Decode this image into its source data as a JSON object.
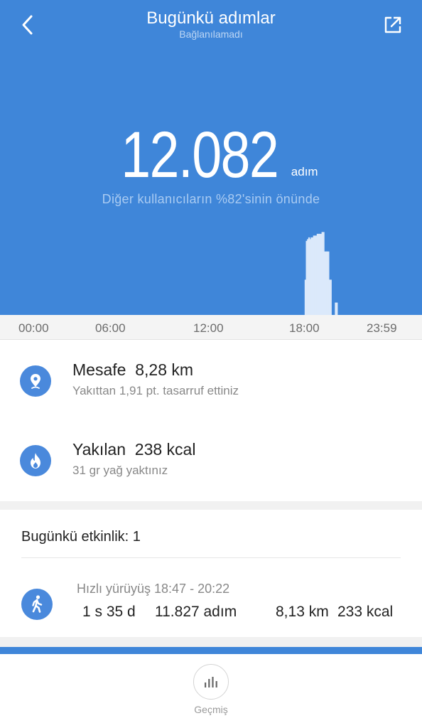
{
  "header": {
    "title": "Bugünkü adımlar",
    "subtitle": "Bağlanılamadı"
  },
  "summary": {
    "steps": "12.082",
    "unit": "adım",
    "ranking": "Diğer kullanıcıların %82'sinin önünde"
  },
  "chart_data": {
    "type": "bar",
    "x": [
      "18:30",
      "18:35",
      "18:40",
      "18:45",
      "18:50",
      "18:55",
      "19:00",
      "19:05",
      "19:10",
      "19:15",
      "19:20",
      "19:25",
      "19:30",
      "19:35",
      "19:40",
      "19:45",
      "19:50",
      "19:55",
      "20:00",
      "20:05",
      "20:10",
      "20:15",
      "20:20",
      "20:25",
      "20:30",
      "20:35",
      "20:40"
    ],
    "values": [
      40,
      84,
      86,
      88,
      86,
      88,
      88,
      90,
      90,
      90,
      92,
      92,
      92,
      92,
      94,
      94,
      72,
      72,
      72,
      72,
      40,
      40,
      0,
      0,
      0,
      14,
      14
    ],
    "ylim": [
      0,
      100
    ],
    "xrange": [
      "00:00",
      "23:59"
    ],
    "color": "#dbe9fb"
  },
  "timeline": {
    "labels": [
      "00:00",
      "06:00",
      "12:00",
      "18:00",
      "23:59"
    ]
  },
  "distance": {
    "label": "Mesafe",
    "value": "8,28 km",
    "sub": "Yakıttan 1,91 pt. tasarruf ettiniz"
  },
  "calories": {
    "label": "Yakılan",
    "value": "238 kcal",
    "sub": "31 gr yağ yaktınız"
  },
  "activity": {
    "title": "Bugünkü etkinlik: 1",
    "name": "Hızlı yürüyüş 18:47 - 20:22",
    "duration": "1 s 35 d",
    "steps": "11.827 adım",
    "distance": "8,13 km",
    "kcal": "233 kcal"
  },
  "tabbar": {
    "history_label": "Geçmiş"
  },
  "colors": {
    "accent": "#3f86d9",
    "icon_bg": "#4a89dc"
  }
}
